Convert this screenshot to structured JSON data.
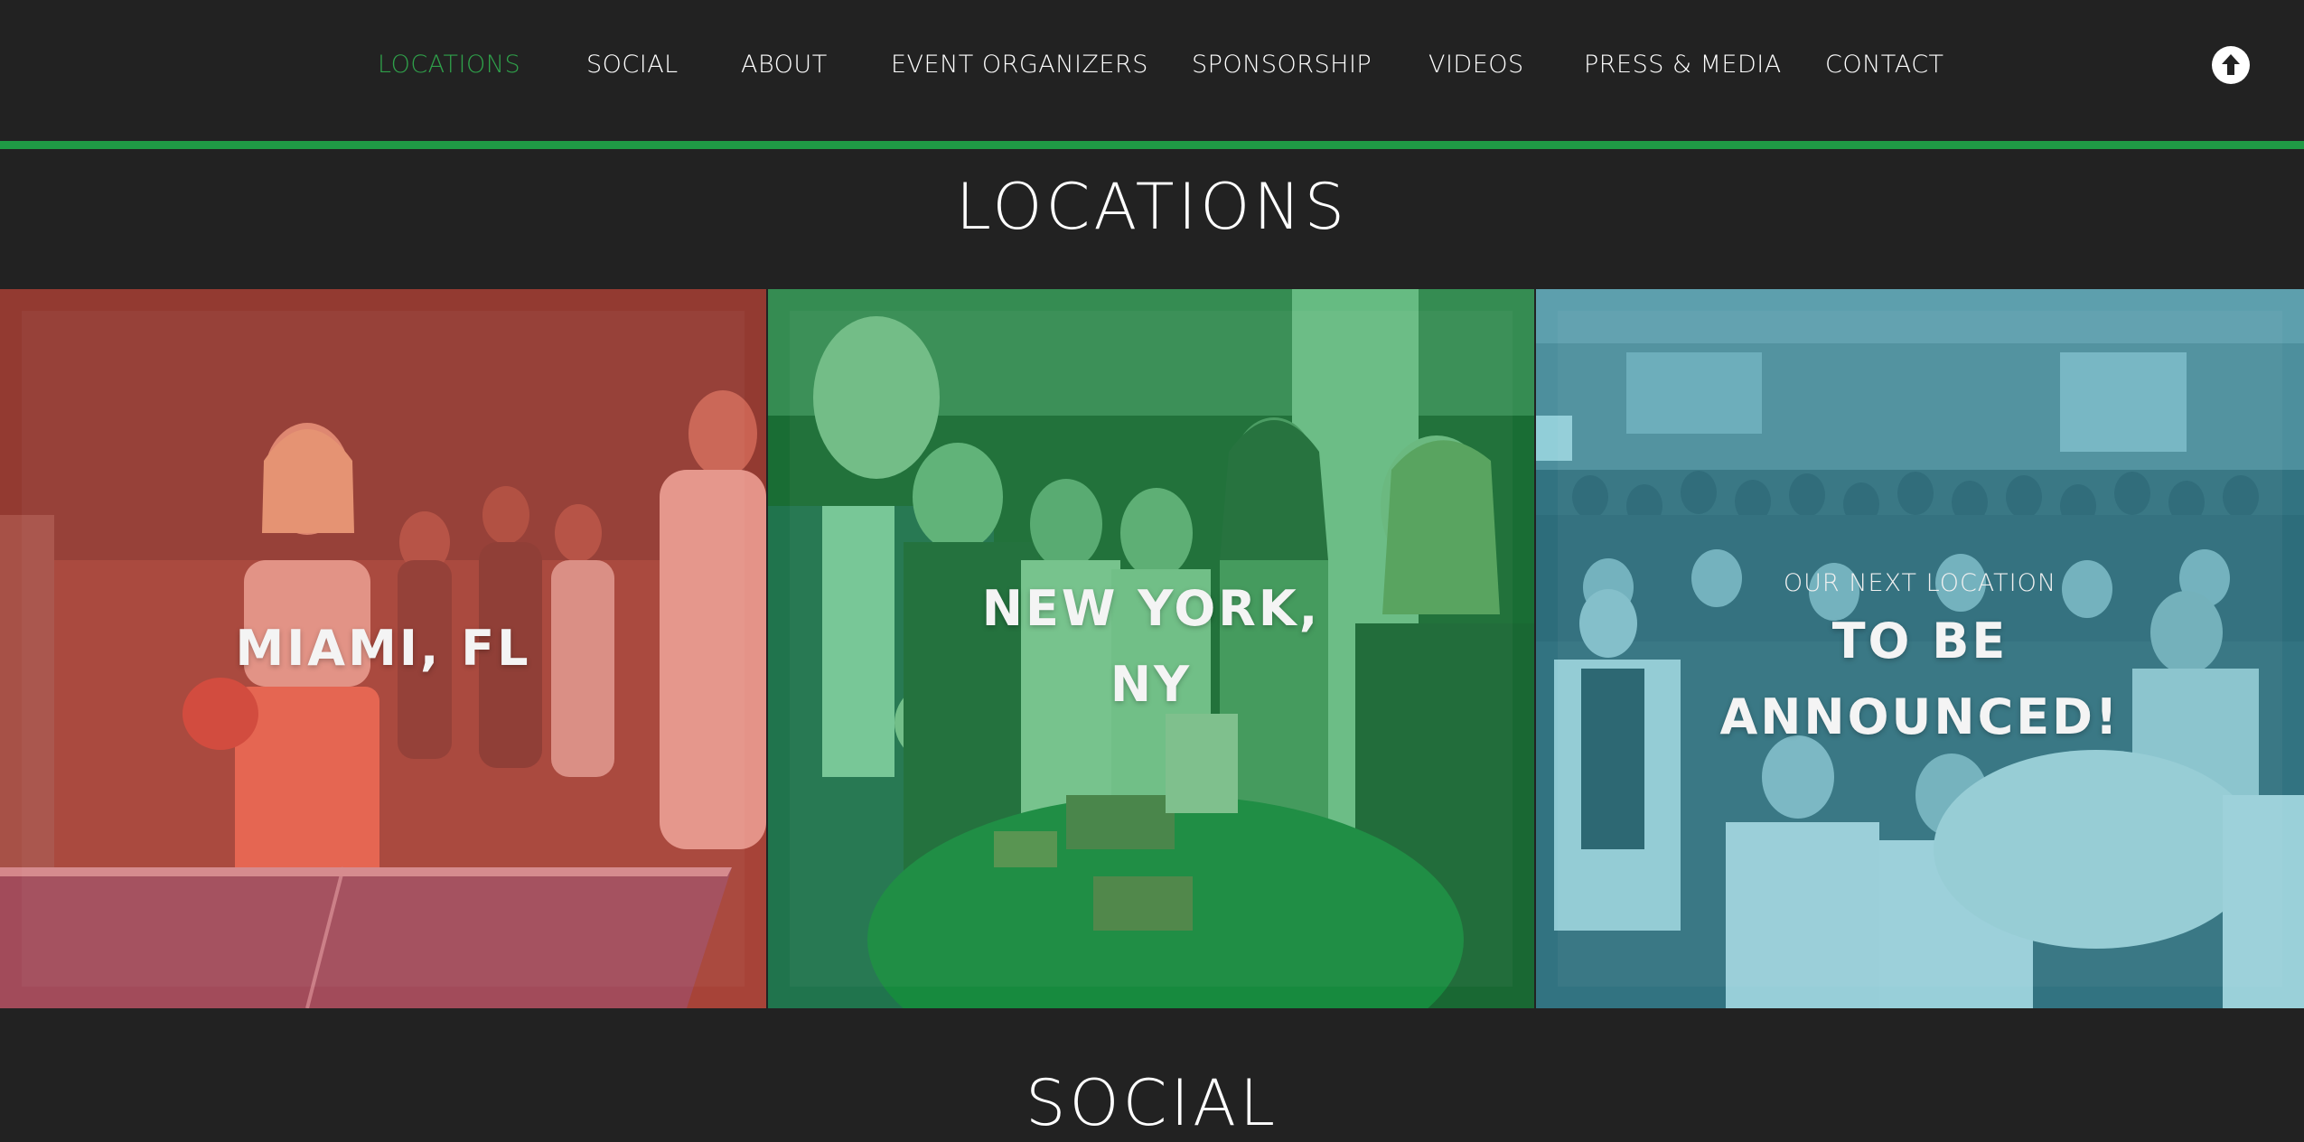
{
  "nav": {
    "items": [
      {
        "label": "LOCATIONS",
        "active": true
      },
      {
        "label": "SOCIAL",
        "active": false
      },
      {
        "label": "ABOUT",
        "active": false
      },
      {
        "label": "EVENT ORGANIZERS",
        "active": false
      },
      {
        "label": "SPONSORSHIP",
        "active": false
      },
      {
        "label": "VIDEOS",
        "active": false
      },
      {
        "label": "PRESS & MEDIA",
        "active": false
      },
      {
        "label": "CONTACT",
        "active": false
      }
    ],
    "scroll_top_icon": "arrow-up-circle-icon"
  },
  "sections": {
    "locations_title": "LOCATIONS",
    "social_title": "SOCIAL"
  },
  "tiles": [
    {
      "title": "MIAMI, FL",
      "overlay_color": "#d9574a"
    },
    {
      "title_line1": "NEW YORK,",
      "title_line2": "NY",
      "overlay_color": "#22a44c"
    },
    {
      "subtitle": "OUR NEXT LOCATION",
      "title_line1": "TO BE",
      "title_line2": "ANNOUNCED!",
      "overlay_color": "#3aa6b8"
    }
  ],
  "colors": {
    "background": "#222222",
    "accent_green": "#1f9a45",
    "active_nav": "#2fa04a"
  }
}
